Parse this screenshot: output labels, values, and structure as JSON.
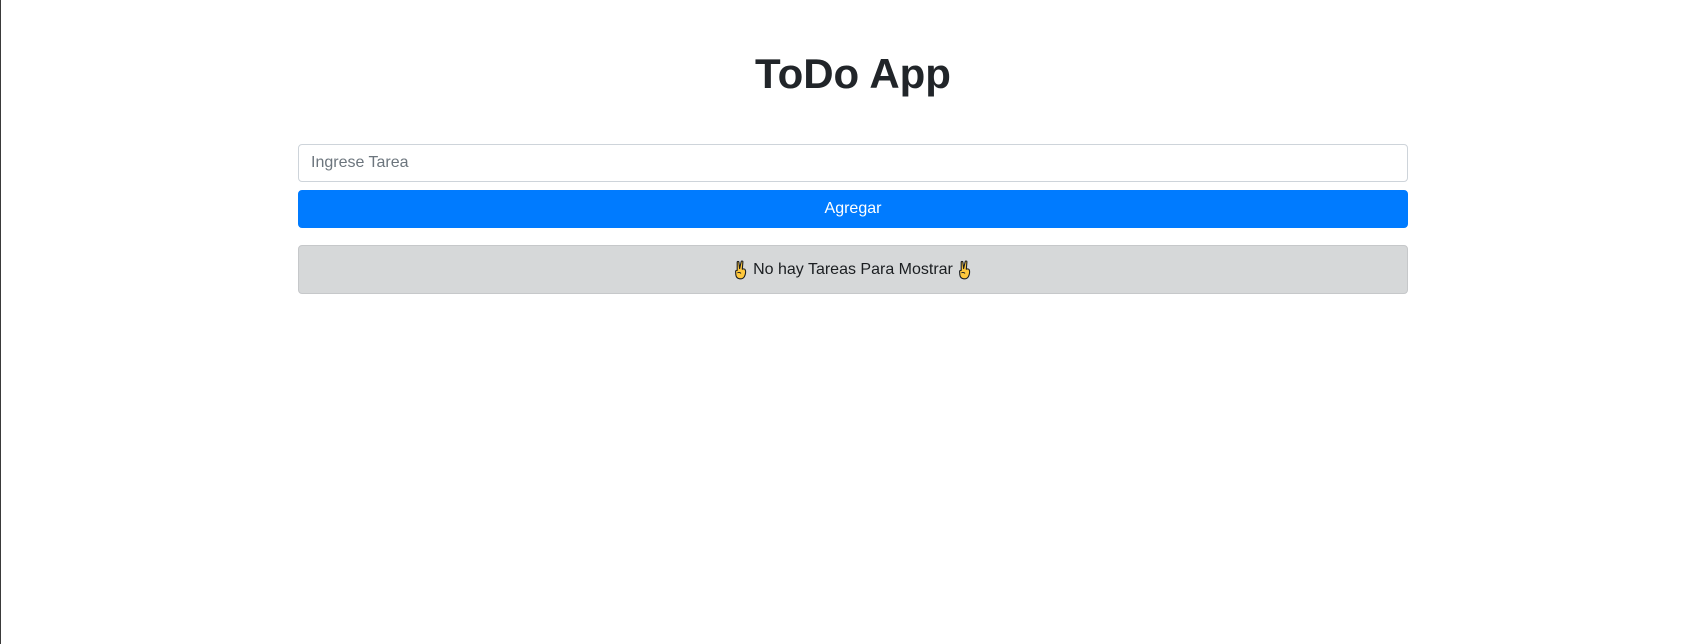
{
  "app": {
    "title": "ToDo App"
  },
  "task_input": {
    "value": "",
    "placeholder": "Ingrese Tarea"
  },
  "add_button": {
    "label": "Agregar"
  },
  "empty_state": {
    "message": "No hay Tareas Para Mostrar",
    "icon": "victory-hand-icon"
  },
  "colors": {
    "primary": "#007bff",
    "alert_background": "#d6d8d9",
    "alert_border": "#c6c8ca",
    "title_text": "#212529",
    "icon_fill": "#ffc83d"
  }
}
